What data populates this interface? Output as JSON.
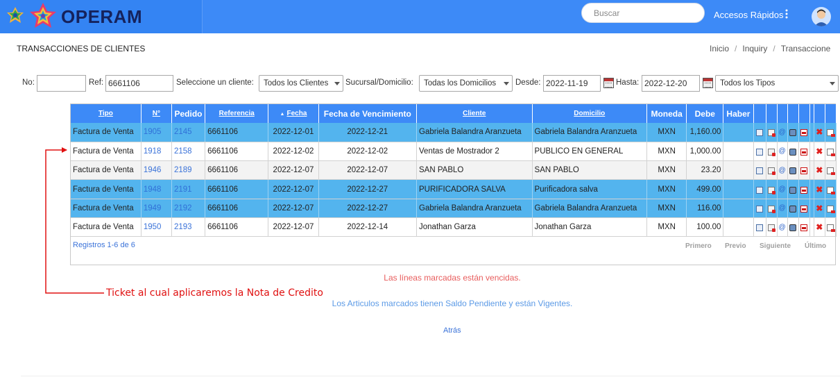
{
  "header": {
    "brand": "OPERAM",
    "search_placeholder": "Buscar",
    "quick_access": "Accesos Rápidos",
    "colors": {
      "bar": "#3d8af7",
      "brand_text": "#15225c"
    }
  },
  "page": {
    "title": "TRANSACCIONES DE CLIENTES",
    "breadcrumb": [
      "Inicio",
      "Inquiry",
      "Transaccione"
    ]
  },
  "filters": {
    "no_label": "No:",
    "no_value": "",
    "ref_label": "Ref:",
    "ref_value": "6661106",
    "client_label": "Seleccione un cliente:",
    "client_selected": "Todos los Clientes",
    "branch_label": "Sucursal/Domicilio:",
    "branch_selected": "Todas los Domicilios",
    "from_label": "Desde:",
    "from_value": "2022-11-19",
    "to_label": "Hasta:",
    "to_value": "2022-12-20",
    "type_selected": "Todos los Tipos"
  },
  "table": {
    "headers": {
      "tipo": "Tipo",
      "no": "N°",
      "pedido": "Pedido",
      "referencia": "Referencia",
      "fecha": "Fecha",
      "vencimiento": "Fecha de Vencimiento",
      "cliente": "Cliente",
      "domicilio": "Domicilio",
      "moneda": "Moneda",
      "debe": "Debe",
      "haber": "Haber"
    },
    "rows": [
      {
        "tipo": "Factura de Venta",
        "no": "1905",
        "pedido": "2145",
        "ref": "6661106",
        "fecha": "2022-12-01",
        "venc": "2022-12-21",
        "cliente": "Gabriela Balandra Aranzueta",
        "domicilio": "Gabriela Balandra Aranzueta",
        "moneda": "MXN",
        "debe": "1,160.00",
        "haber": ""
      },
      {
        "tipo": "Factura de Venta",
        "no": "1918",
        "pedido": "2158",
        "ref": "6661106",
        "fecha": "2022-12-02",
        "venc": "2022-12-02",
        "cliente": "Ventas de Mostrador 2",
        "domicilio": "PUBLICO EN GENERAL",
        "moneda": "MXN",
        "debe": "1,000.00",
        "haber": ""
      },
      {
        "tipo": "Factura de Venta",
        "no": "1946",
        "pedido": "2189",
        "ref": "6661106",
        "fecha": "2022-12-07",
        "venc": "2022-12-07",
        "cliente": "SAN PABLO",
        "domicilio": "SAN PABLO",
        "moneda": "MXN",
        "debe": "23.20",
        "haber": ""
      },
      {
        "tipo": "Factura de Venta",
        "no": "1948",
        "pedido": "2191",
        "ref": "6661106",
        "fecha": "2022-12-07",
        "venc": "2022-12-27",
        "cliente": "PURIFICADORA SALVA",
        "domicilio": "Purificadora salva",
        "moneda": "MXN",
        "debe": "499.00",
        "haber": ""
      },
      {
        "tipo": "Factura de Venta",
        "no": "1949",
        "pedido": "2192",
        "ref": "6661106",
        "fecha": "2022-12-07",
        "venc": "2022-12-27",
        "cliente": "Gabriela Balandra Aranzueta",
        "domicilio": "Gabriela Balandra Aranzueta",
        "moneda": "MXN",
        "debe": "116.00",
        "haber": ""
      },
      {
        "tipo": "Factura de Venta",
        "no": "1950",
        "pedido": "2193",
        "ref": "6661106",
        "fecha": "2022-12-07",
        "venc": "2022-12-14",
        "cliente": "Jonathan Garza",
        "domicilio": "Jonathan Garza",
        "moneda": "MXN",
        "debe": "100.00",
        "haber": ""
      }
    ],
    "highlight_color": "#53b4ee",
    "records_text": "Registros 1-6 de 6",
    "pager": {
      "first": "Primero",
      "prev": "Previo",
      "next": "Siguiente",
      "last": "Último"
    }
  },
  "annotation": {
    "text": "Ticket al cual aplicaremos la Nota de Credito",
    "color": "#e01010"
  },
  "messages": {
    "overdue": "Las líneas marcadas están vencidas.",
    "pending": "Los Articulos marcados tienen Saldo Pendiente y están Vigentes.",
    "back": "Atrás"
  }
}
